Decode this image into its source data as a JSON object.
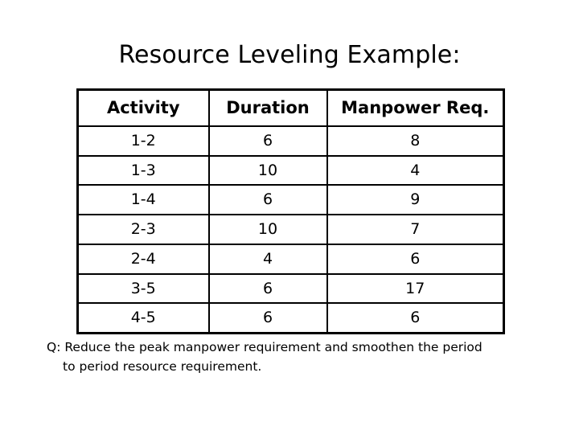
{
  "slide": {
    "title": "Resource Leveling Example:",
    "background_color": "#ffffff",
    "text_color": "#000000"
  },
  "table": {
    "headers": {
      "activity": "Activity",
      "duration": "Duration",
      "manpower": "Manpower Req."
    },
    "rows": [
      {
        "activity": "1-2",
        "duration": "6",
        "manpower": "8"
      },
      {
        "activity": "1-3",
        "duration": "10",
        "manpower": "4"
      },
      {
        "activity": "1-4",
        "duration": "6",
        "manpower": "9"
      },
      {
        "activity": "2-3",
        "duration": "10",
        "manpower": "7"
      },
      {
        "activity": "2-4",
        "duration": "4",
        "manpower": "6"
      },
      {
        "activity": "3-5",
        "duration": "6",
        "manpower": "17"
      },
      {
        "activity": "4-5",
        "duration": "6",
        "manpower": "6"
      }
    ]
  },
  "caption": {
    "line1": "Q: Reduce the peak manpower requirement and smoothen the period",
    "line2": "to period resource requirement."
  }
}
